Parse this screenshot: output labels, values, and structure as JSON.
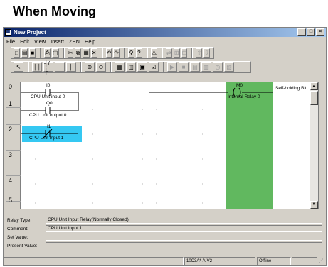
{
  "heading": "When Moving",
  "window": {
    "title": "New Project",
    "minimize": "_",
    "maximize": "□",
    "close": "×"
  },
  "menu": [
    "File",
    "Edit",
    "View",
    "Insert",
    "ZEN",
    "Help"
  ],
  "toolbar1": {
    "buttons": [
      {
        "icon": "new-file-icon",
        "glyph": "□"
      },
      {
        "icon": "open-folder-icon",
        "glyph": "▤"
      },
      {
        "icon": "save-icon",
        "glyph": "■"
      },
      {
        "icon": "print-icon",
        "glyph": "⎙"
      },
      {
        "icon": "print-preview-icon",
        "glyph": "▢"
      },
      {
        "icon": "cut-icon",
        "glyph": "✂"
      },
      {
        "icon": "copy-icon",
        "glyph": "⧉"
      },
      {
        "icon": "paste-icon",
        "glyph": "▦"
      },
      {
        "icon": "delete-icon",
        "glyph": "✕"
      },
      {
        "icon": "undo-icon",
        "glyph": "↶"
      },
      {
        "icon": "redo-icon",
        "glyph": "↷"
      },
      {
        "icon": "find-icon",
        "glyph": "⚲"
      },
      {
        "icon": "help-icon",
        "glyph": "?"
      },
      {
        "icon": "warning-icon",
        "glyph": "⚠"
      },
      {
        "icon": "transfer-icon",
        "glyph": "⇄"
      },
      {
        "icon": "compare-icon",
        "glyph": "⊞"
      },
      {
        "icon": "verify-icon",
        "glyph": "⊟"
      },
      {
        "icon": "upload-icon",
        "glyph": "⇧"
      },
      {
        "icon": "download-icon",
        "glyph": "⇩"
      }
    ]
  },
  "toolbar2": {
    "buttons": [
      {
        "icon": "select-pointer-icon",
        "glyph": "↖"
      },
      {
        "icon": "contact-no-icon",
        "glyph": "┤├"
      },
      {
        "icon": "contact-nc-icon",
        "glyph": "┤/├"
      },
      {
        "icon": "horizontal-line-icon",
        "glyph": "─"
      },
      {
        "icon": "vertical-line-icon",
        "glyph": "│"
      },
      {
        "icon": "zoom-in-icon",
        "glyph": "⊕"
      },
      {
        "icon": "zoom-out-icon",
        "glyph": "⊖"
      },
      {
        "icon": "grid-icon",
        "glyph": "▦"
      },
      {
        "icon": "monitor-icon",
        "glyph": "◫"
      },
      {
        "icon": "io-table-icon",
        "glyph": "▣"
      },
      {
        "icon": "check-icon",
        "glyph": "☑"
      },
      {
        "icon": "run-icon",
        "glyph": "▶"
      },
      {
        "icon": "stop-icon",
        "glyph": "■"
      },
      {
        "icon": "program-icon",
        "glyph": "▤"
      },
      {
        "icon": "table-icon",
        "glyph": "▥"
      },
      {
        "icon": "timer-icon",
        "glyph": "◷"
      },
      {
        "icon": "setup-icon",
        "glyph": "▧"
      }
    ]
  },
  "ladder": {
    "rung_numbers": [
      "0",
      "1",
      "2",
      "3",
      "4",
      "5"
    ],
    "contacts": [
      {
        "address": "I0",
        "comment": "CPU Unit input 0",
        "type": "NO"
      },
      {
        "address": "Q0",
        "comment": "CPU Unit output 0",
        "type": "NO"
      },
      {
        "address": "I1",
        "comment": "CPU Unit input 1",
        "type": "NC"
      }
    ],
    "coil": {
      "address": "M0",
      "comment": "Internal Relay 0"
    },
    "rung_comment": "Self-holding Bit"
  },
  "info": {
    "relay_type_label": "Relay Type:",
    "relay_type_value": "CPU Unit Input Relay(Normally Closed)",
    "comment_label": "Comment:",
    "comment_value": "CPU Unit input 1",
    "set_value_label": "Set Value:",
    "set_value_value": "",
    "present_value_label": "Present Value:",
    "present_value_value": ""
  },
  "status": {
    "model": "10C3A*-A-V2",
    "mode": "Offline"
  },
  "colors": {
    "selection": "#35c8f2",
    "coil_column": "#61b85f",
    "titlebar_start": "#0a246a",
    "titlebar_end": "#a6caf0"
  }
}
